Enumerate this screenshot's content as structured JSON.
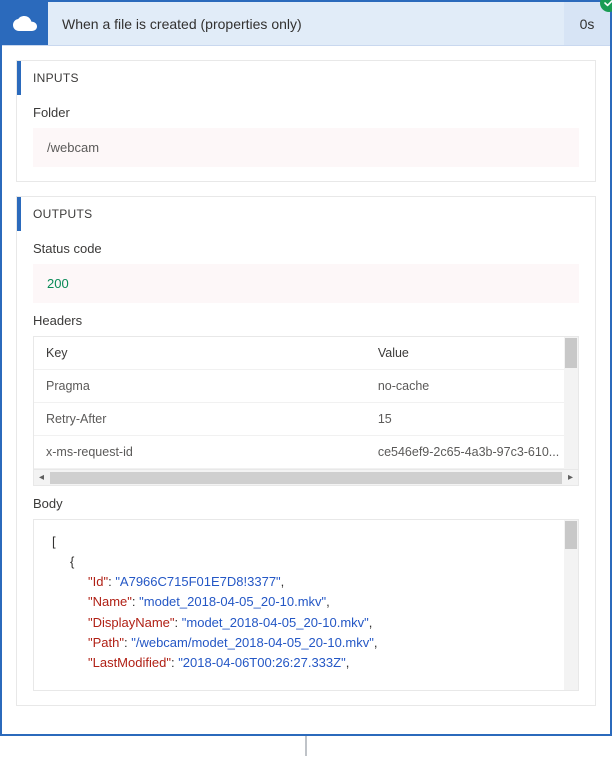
{
  "header": {
    "title": "When a file is created (properties only)",
    "duration": "0s",
    "status": "success"
  },
  "inputs": {
    "section_title": "INPUTS",
    "folder_label": "Folder",
    "folder_value": "/webcam"
  },
  "outputs": {
    "section_title": "OUTPUTS",
    "status_label": "Status code",
    "status_value": "200",
    "headers_label": "Headers",
    "headers_table": {
      "cols": [
        "Key",
        "Value"
      ],
      "rows": [
        {
          "key": "Pragma",
          "value": "no-cache"
        },
        {
          "key": "Retry-After",
          "value": "15"
        },
        {
          "key": "x-ms-request-id",
          "value": "ce546ef9-2c65-4a3b-97c3-610..."
        }
      ]
    },
    "body_label": "Body",
    "body_json": [
      {
        "kind": "bracket",
        "indent": 0,
        "text": "["
      },
      {
        "kind": "bracket",
        "indent": 1,
        "text": "{"
      },
      {
        "kind": "pair",
        "indent": 2,
        "key": "Id",
        "valType": "str",
        "value": "A7966C715F01E7D8!3377",
        "comma": true
      },
      {
        "kind": "pair",
        "indent": 2,
        "key": "Name",
        "valType": "str",
        "value": "modet_2018-04-05_20-10.mkv",
        "comma": true
      },
      {
        "kind": "pair",
        "indent": 2,
        "key": "DisplayName",
        "valType": "str",
        "value": "modet_2018-04-05_20-10.mkv",
        "comma": true
      },
      {
        "kind": "pair",
        "indent": 2,
        "key": "Path",
        "valType": "str",
        "value": "/webcam/modet_2018-04-05_20-10.mkv",
        "comma": true
      },
      {
        "kind": "pair",
        "indent": 2,
        "key": "LastModified",
        "valType": "str",
        "value": "2018-04-06T00:26:27.333Z",
        "comma": true
      }
    ]
  }
}
